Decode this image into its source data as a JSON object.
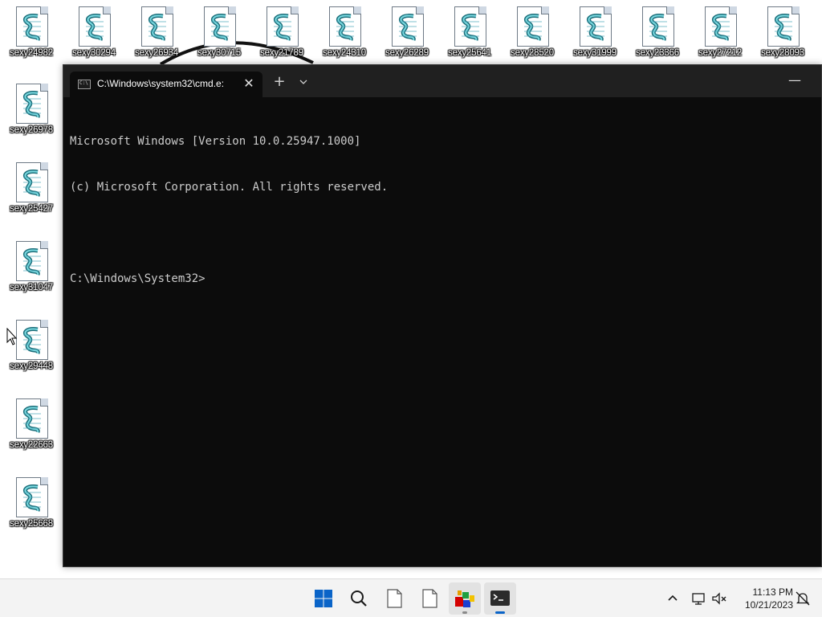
{
  "desktop": {
    "icons_top": [
      "sexy24982",
      "sexy30294",
      "sexy26934",
      "sexy30715",
      "sexy21789",
      "sexy24310",
      "sexy26289",
      "sexy25641",
      "sexy28520",
      "sexy31999",
      "sexy23366",
      "sexy27212",
      "sexy28093"
    ],
    "icons_left": [
      "sexy26978",
      "sexy25427",
      "sexy31047",
      "sexy29448",
      "sexy22663",
      "sexy25668"
    ],
    "icon_type": "script-file-icon"
  },
  "terminal": {
    "tab_title": "C:\\Windows\\system32\\cmd.e:",
    "tab_icon_text": "C:\\",
    "close_glyph": "✕",
    "new_tab_glyph": "+",
    "minimize_glyph": "—",
    "lines": [
      "Microsoft Windows [Version 10.0.25947.1000]",
      "(c) Microsoft Corporation. All rights reserved.",
      "",
      "C:\\Windows\\System32>"
    ],
    "background": "#0c0c0c",
    "text_color": "#cccccc"
  },
  "taskbar": {
    "time": "11:13 PM",
    "date": "10/21/2023",
    "accent": "#0a64c8"
  }
}
